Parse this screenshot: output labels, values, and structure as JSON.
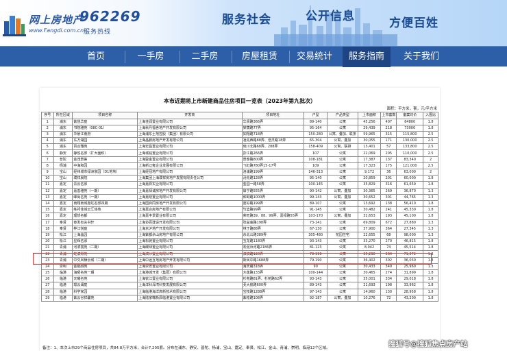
{
  "banner": {
    "site_name": "网上房地产",
    "hotline": "962269",
    "url": "www.Fangdi.com.cn",
    "hotline_label": "服务热线",
    "slogans": [
      "服务社会",
      "公开信息",
      "方便百姓"
    ]
  },
  "nav": {
    "items": [
      "首页",
      "一手房",
      "二手房",
      "房屋租赁",
      "交易统计",
      "服务指南",
      "关于我们"
    ],
    "active": "服务指南"
  },
  "doc": {
    "title": "本市近期将上市新建商品住房项目一览表（2023年第九批次）",
    "unit": "面积：平方米，套，元/平方米",
    "headers": [
      "序号",
      "所在区域",
      "项目名称",
      "开发商",
      "项目地址",
      "户型",
      "产品类型",
      "上市面积",
      "上市套数",
      "备案均价",
      "入围比"
    ],
    "rows": [
      [
        "1",
        "浦东",
        "紫悦华庭",
        "上海佳润置业有限公司",
        "华贤路366弄",
        "89-140",
        "公寓",
        "45,256",
        "407",
        "64800",
        "1.8"
      ],
      [
        "2",
        "浦东",
        "书院雅苑（08C-01）",
        "上海秋丹福舍地产开发有限公司",
        "棠荫路77弄",
        "95-164",
        "公寓",
        "29,439",
        "218",
        "73000",
        "1.8"
      ],
      [
        "3",
        "浦东",
        "华景江南府",
        "上海浦东土地控股（集团）有限公司",
        "如翔路718弄",
        "150-280",
        "公寓、叠加、联排",
        "59,965",
        "315",
        "115,800",
        "2.5"
      ],
      [
        "4",
        "浦东",
        "东方湖园",
        "上海晶鹏房地产开发有限公司",
        "凌兆西路88弄、浩灵路18弄",
        "65-304",
        "公寓、叠加",
        "30,055",
        "171",
        "130,000",
        "2.5"
      ],
      [
        "5",
        "浦东",
        "百合雅苑",
        "上海宏昌置业有限公司",
        "晓川北路68弄、288弄",
        "158-409",
        "公寓、联排",
        "13,401",
        "57",
        "133,800",
        "2.5"
      ],
      [
        "6",
        "静安",
        "静悦名邸（扩大面积）",
        "上海城铭置业有限公司",
        "彭江路266弄",
        "107",
        "公寓",
        "22,069",
        "205",
        "110,000",
        "2.5"
      ],
      [
        "7",
        "普陀",
        "金茂景荟",
        "上海骏金置业有限公司",
        "景泰路800弄",
        "108-181",
        "公寓",
        "17,387",
        "137",
        "83,340",
        "2"
      ],
      [
        "8",
        "杨浦",
        "中海和园",
        "上海新辽雍企业发展有限公司",
        "飞虹路780弄15-17号",
        "109",
        "公寓",
        "17,323",
        "175",
        "121,000",
        "2.5"
      ],
      [
        "9",
        "宝山",
        "经纬城市绿洲家园（D1地块）",
        "上海经冠地产有限公司",
        "洛浦路199弄",
        "146-313",
        "公寓",
        "9,172",
        "36",
        "63,000",
        "2"
      ],
      [
        "10",
        "宝山",
        "璞祥晨院",
        "上海集团上海璞祥房地产发展有限责任公司",
        "汤兆路128弄",
        "95-140",
        "公寓",
        "20,859",
        "201",
        "60,000",
        "1.8"
      ],
      [
        "11",
        "嘉定",
        "青云名邸",
        "上海嘉辰实业有限公司",
        "金园一路58弄",
        "100-145",
        "公寓",
        "35,829",
        "316",
        "61,659",
        "1.8"
      ],
      [
        "12",
        "嘉定",
        "嘉善雅苑（一期）",
        "上海嘉禄诚房地产开发有限公司",
        "启宁路555弄",
        "90-142",
        "公寓、叠加",
        "30,365",
        "269",
        "36,870",
        "1.3"
      ],
      [
        "13",
        "嘉定",
        "峰尚名苑（一期）",
        "上海嘉晓置业有限公司",
        "和颐路1000弄",
        "99-143",
        "公寓、叠加",
        "30,652",
        "301",
        "44,765",
        "1.3"
      ],
      [
        "14",
        "嘉定",
        "南翔南城嘉虹名邸四期",
        "上海国启同房地产开发有限公司",
        "嘉好路199弄",
        "89-107",
        "公寓",
        "13,692",
        "138",
        "56,410",
        "1.8"
      ],
      [
        "15",
        "嘉定",
        "练祁佳城云汇佳苑",
        "上海嘉合房地产有限公司",
        "竹篮路99弄",
        "91-145",
        "公寓",
        "30,482",
        "241",
        "45,330",
        "1.8"
      ],
      [
        "16",
        "嘉定",
        "理想名都",
        "上海嘉丰景置业有限公司",
        "荣旺路39、88、99弄、嘉禄路55弄",
        "103-170",
        "公寓、叠加",
        "32,653",
        "193",
        "45,100",
        "1.8"
      ],
      [
        "17",
        "奉贤",
        "泰发有言书轩",
        "上海协百建设开发有限公司",
        "张益庙路198弄",
        "73-141",
        "公寓",
        "69,809",
        "672",
        "27,880",
        "1.3"
      ],
      [
        "18",
        "奉贤",
        "桦江悦庭",
        "上海京沪地产开发有限公司",
        "林于路88弄",
        "67-130",
        "公寓",
        "37,900",
        "364",
        "27,345",
        "1.3"
      ],
      [
        "19",
        "松江",
        "上海晶园",
        "上海紫都佘山房地产有限公司",
        "佘北公路389弄",
        "305-480",
        "花园住宅",
        "22,655",
        "68",
        "98,000",
        "1.3"
      ],
      [
        "20",
        "松江",
        "星辉名邸",
        "上海松驰置业有限公司",
        "玉龙路1180弄",
        "93-143",
        "公寓",
        "33,270",
        "270",
        "46,815",
        "1.8"
      ],
      [
        "21",
        "青浦",
        "河滨丽苑（二期）",
        "上海碳绿置业有限公司",
        "淞泥浜河路2186弄",
        "81-123",
        "公寓",
        "8,042",
        "74",
        "45,514",
        "1.8"
      ],
      [
        "22",
        "青浦",
        "虹滨熙苑",
        "上海滨沙置业有限公司",
        "滨滨路128弄",
        "79-199",
        "公寓",
        "35,290",
        "264",
        "71,372",
        "1.8"
      ],
      [
        "23",
        "青浦",
        "中交凤栖云城（二期）",
        "上海中远互地房地产开发有限公司",
        "新凤中路1688弄",
        "79-190",
        "公寓",
        "36,402",
        "302",
        "36,030",
        "1.3"
      ],
      [
        "24",
        "崇明",
        "金银融苑",
        "上海崇安置业有限公司",
        "海天路318弄",
        "90",
        "公寓",
        "30,433",
        "340",
        "25,960",
        "1.3"
      ],
      [
        "25",
        "临港",
        "海曜名苑一期",
        "上海港城开发（集团）有限公司",
        "木莲路133弄",
        "100-144",
        "公寓",
        "30,465",
        "274",
        "31,899",
        "1.8"
      ],
      [
        "26",
        "临港",
        "天曦名苑",
        "上海钦江置业有限公司",
        "杉苑路81弄、杉苑路62弄",
        "93-143",
        "公寓",
        "35,001",
        "334",
        "29,018",
        "1.8"
      ],
      [
        "27",
        "临港",
        "璟云澜庭",
        "上海洋科深湾科技发展有限公司",
        "芙大航路600弄",
        "89-143",
        "公寓",
        "21,693",
        "198",
        "33,962",
        "1.8"
      ],
      [
        "28",
        "临港",
        "科学家园",
        "上海临港海洋高新技术有限公司",
        "宝枝路1288弄",
        "97-143",
        "公寓",
        "14,960",
        "130",
        "28,958",
        "1.8"
      ],
      [
        "29",
        "临港",
        "紫云谷祥馨苑",
        "上海陆家嘴新辰临港置业有限公司",
        "紫崧路108弄",
        "92-187",
        "公寓、叠加",
        "10,276",
        "72",
        "43,200",
        "1.8"
      ]
    ],
    "footnote": "备注：1、本次上市29个商品住房项目，共84.8万平方米，合计7,205套。分布在浦东、静安、普陀、杨浦、宝山、嘉定、奉贤、松江、金山、青浦、崇明、临港12个区域。"
  },
  "watermark": "搜狐号@搜狐焦点房产站"
}
